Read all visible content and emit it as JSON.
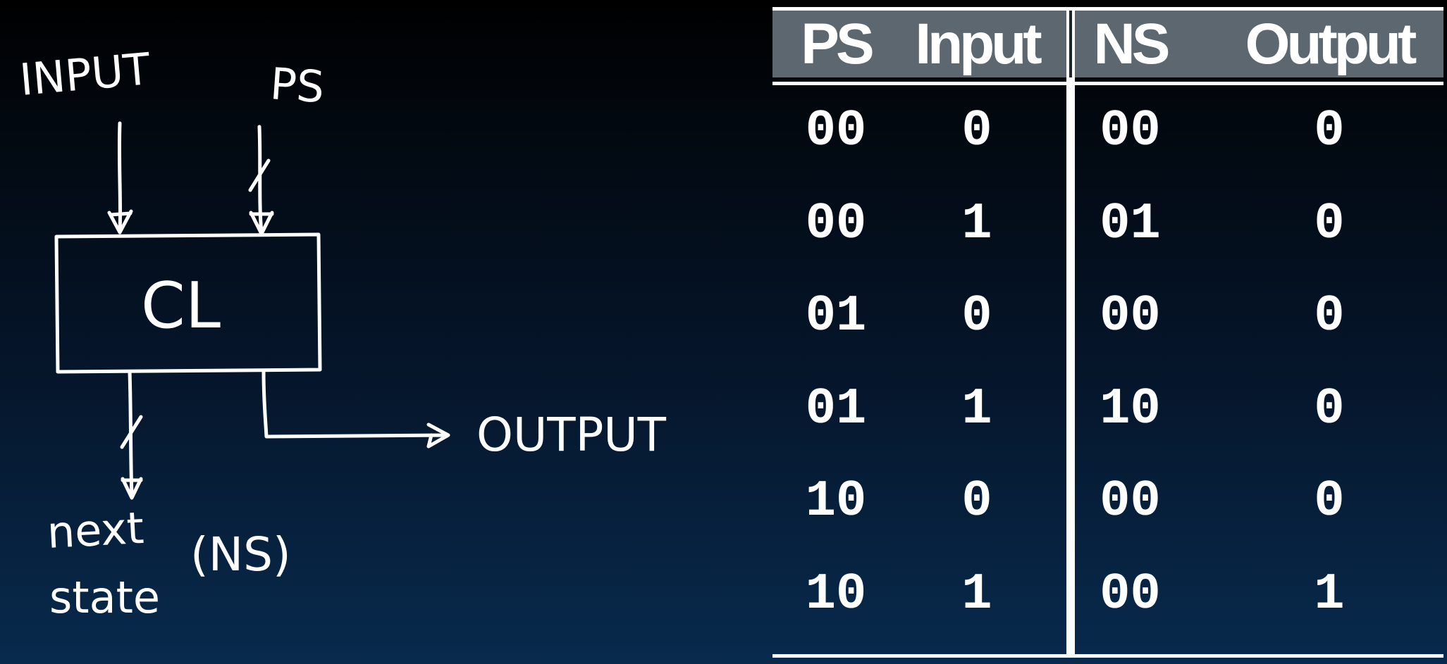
{
  "diagram": {
    "input_label": "INPUT",
    "ps_label": "PS",
    "block_label": "CL",
    "output_label": "OUTPUT",
    "next_label": "next",
    "state_label": "state",
    "ns_label": "(NS)"
  },
  "table": {
    "columns": [
      "PS",
      "Input",
      "NS",
      "Output"
    ],
    "rows": [
      [
        "00",
        "0",
        "00",
        "0"
      ],
      [
        "00",
        "1",
        "01",
        "0"
      ],
      [
        "01",
        "0",
        "00",
        "0"
      ],
      [
        "01",
        "1",
        "10",
        "0"
      ],
      [
        "10",
        "0",
        "00",
        "0"
      ],
      [
        "10",
        "1",
        "00",
        "1"
      ]
    ]
  },
  "colors": {
    "header_bg": "#5c6770",
    "background_top": "#000000",
    "background_bottom": "#082a4d",
    "ink": "#ffffff"
  }
}
